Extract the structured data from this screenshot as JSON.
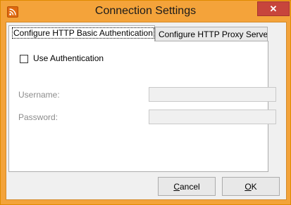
{
  "window": {
    "title": "Connection Settings",
    "close_label": "✕",
    "accent_color": "#f4a33a"
  },
  "tabs": [
    {
      "label": "Configure HTTP Basic Authentication",
      "active": true
    },
    {
      "label": "Configure HTTP Proxy Server",
      "active": false
    }
  ],
  "auth": {
    "use_authentication_label": "Use Authentication",
    "use_authentication_checked": false,
    "username_label": "Username:",
    "username_value": "",
    "password_label": "Password:",
    "password_value": ""
  },
  "buttons": {
    "cancel_first": "C",
    "cancel_rest": "ancel",
    "ok_first": "O",
    "ok_rest": "K"
  },
  "icons": {
    "app": "rss-feed-icon",
    "close": "close-icon"
  }
}
